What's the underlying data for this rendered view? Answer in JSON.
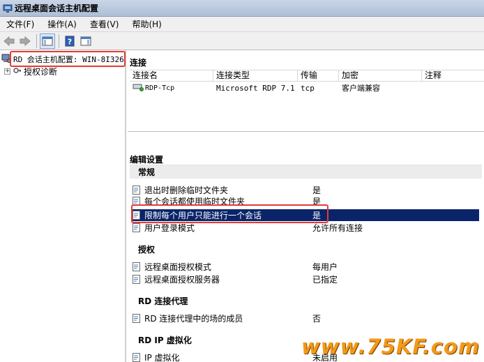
{
  "window": {
    "title": "远程桌面会话主机配置"
  },
  "menu": [
    "文件(F)",
    "操作(A)",
    "查看(V)",
    "帮助(H)"
  ],
  "toolbar": {
    "back": "back-arrow-icon",
    "forward": "forward-arrow-icon",
    "console_tree": "console-tree-icon",
    "help": "help-icon",
    "action_pane": "action-pane-icon"
  },
  "tree": {
    "root": "RD 会话主机配置: WIN-8I326",
    "child": "授权诊断"
  },
  "connections": {
    "title": "连接",
    "columns": [
      "连接名",
      "连接类型",
      "传输",
      "加密",
      "注释"
    ],
    "rows": [
      {
        "name": "RDP-Tcp",
        "type": "Microsoft RDP 7.1",
        "transport": "tcp",
        "encryption": "客户端兼容",
        "comment": ""
      }
    ]
  },
  "edit_settings": {
    "title": "编辑设置",
    "groups": [
      {
        "name": "常规",
        "items": [
          {
            "name": "退出时删除临时文件夹",
            "value": "是"
          },
          {
            "name": "每个会话都使用临时文件夹",
            "value": "是"
          },
          {
            "name": "限制每个用户只能进行一个会话",
            "value": "是",
            "selected": true
          },
          {
            "name": "用户登录模式",
            "value": "允许所有连接"
          }
        ]
      },
      {
        "name": "授权",
        "items": [
          {
            "name": "远程桌面授权模式",
            "value": "每用户"
          },
          {
            "name": "远程桌面授权服务器",
            "value": "已指定"
          }
        ]
      },
      {
        "name": "RD 连接代理",
        "items": [
          {
            "name": "RD 连接代理中的场的成员",
            "value": "否"
          }
        ]
      },
      {
        "name": "RD IP 虚拟化",
        "items": [
          {
            "name": "IP 虚拟化",
            "value": "未启用"
          }
        ]
      }
    ]
  },
  "watermark": "www.75KF.com",
  "colors": {
    "selection": "#0a246a",
    "highlight_box": "#e53935",
    "watermark": "#f29a18"
  }
}
